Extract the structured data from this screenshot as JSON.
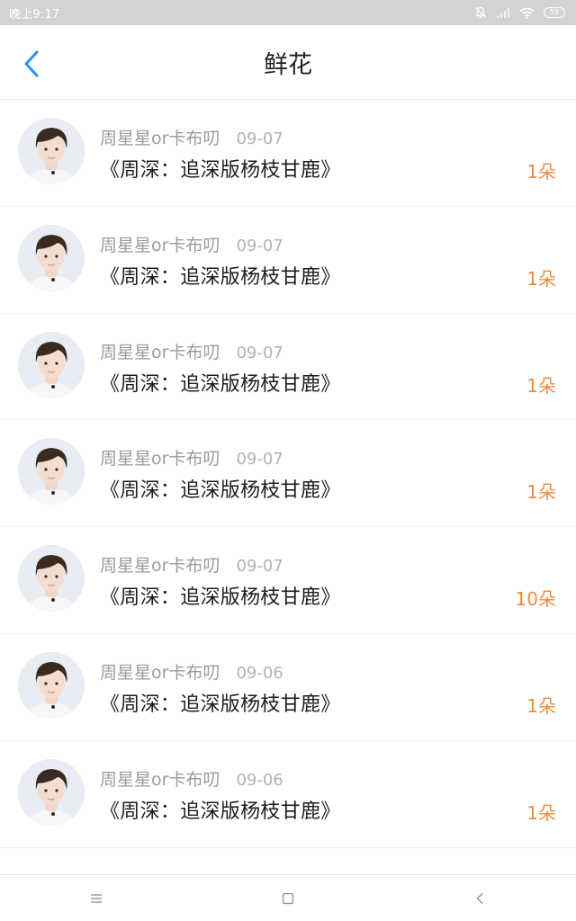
{
  "status_bar": {
    "time": "晚上9:17",
    "battery_level": "59",
    "icons": [
      "bell-mute-icon",
      "signal-icon",
      "wifi-icon",
      "battery-icon"
    ]
  },
  "header": {
    "title": "鲜花",
    "back_icon": "chevron-left-icon",
    "accent_color": "#2196f3"
  },
  "list": {
    "items": [
      {
        "user": "周星星or卡布叨",
        "date": "09-07",
        "title": "《周深：追深版杨枝甘鹿》",
        "count": "1朵"
      },
      {
        "user": "周星星or卡布叨",
        "date": "09-07",
        "title": "《周深：追深版杨枝甘鹿》",
        "count": "1朵"
      },
      {
        "user": "周星星or卡布叨",
        "date": "09-07",
        "title": "《周深：追深版杨枝甘鹿》",
        "count": "1朵"
      },
      {
        "user": "周星星or卡布叨",
        "date": "09-07",
        "title": "《周深：追深版杨枝甘鹿》",
        "count": "1朵"
      },
      {
        "user": "周星星or卡布叨",
        "date": "09-07",
        "title": "《周深：追深版杨枝甘鹿》",
        "count": "10朵"
      },
      {
        "user": "周星星or卡布叨",
        "date": "09-06",
        "title": "《周深：追深版杨枝甘鹿》",
        "count": "1朵"
      },
      {
        "user": "周星星or卡布叨",
        "date": "09-06",
        "title": "《周深：追深版杨枝甘鹿》",
        "count": "1朵"
      }
    ],
    "count_color": "#f08a3c"
  },
  "nav_bar": {
    "buttons": [
      "menu-icon",
      "home-square-icon",
      "back-triangle-icon"
    ]
  }
}
